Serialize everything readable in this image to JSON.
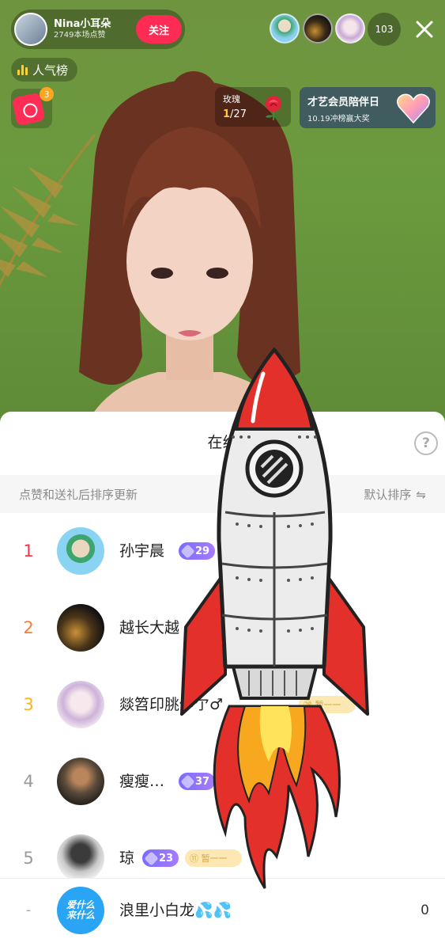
{
  "host": {
    "name": "Nina小耳朵",
    "likes": "2749本场点赞",
    "follow_label": "关注"
  },
  "viewers": {
    "count": "103"
  },
  "popularity_rank": {
    "label": "人气榜"
  },
  "red_packet": {
    "badge": "3"
  },
  "rose_task": {
    "label": "玫瑰",
    "current": "1",
    "total": "/27"
  },
  "event_banner": {
    "title": "才艺会员陪伴日",
    "subtitle": "10.19冲榜赢大奖"
  },
  "sheet": {
    "title": "在线",
    "help_icon": "?",
    "sort_hint": "点赞和送礼后排序更新",
    "sort_label": "默认排序",
    "sort_icon": "⇋"
  },
  "ranking": [
    {
      "rank": "1",
      "name": "孙宇晨",
      "level": "29",
      "rank_color": "#f2374a"
    },
    {
      "rank": "2",
      "name": "越长大越",
      "level": "",
      "rank_color": "#ff7a2e"
    },
    {
      "rank": "3",
      "name": "燚笤印脁伊亇♂",
      "level": "",
      "fan": "㉘ 暂一一",
      "rank_color": "#ffb21f"
    },
    {
      "rank": "4",
      "name": "瘦瘦…",
      "level": "37",
      "fan": "㉘",
      "rank_color": "#9a9a9a"
    },
    {
      "rank": "5",
      "name": "琼",
      "level": "23",
      "fan": "⑪ 暂一一",
      "rank_color": "#9a9a9a"
    }
  ],
  "me": {
    "rank": "-",
    "avatar_text": "爱什么\n来什么",
    "name": "浪里小白龙💦💦",
    "score": "0"
  },
  "icons": {
    "close": "close-icon",
    "help": "help-icon",
    "rank_bars": "bar-chart-icon",
    "rose": "rose-icon",
    "heart": "heart-icon",
    "level_gem": "gem-icon",
    "rocket": "rocket-sticker"
  },
  "colors": {
    "follow": "#fe2c55",
    "level_badge": "#8a72ff",
    "fan_badge": "#fde8b4"
  }
}
